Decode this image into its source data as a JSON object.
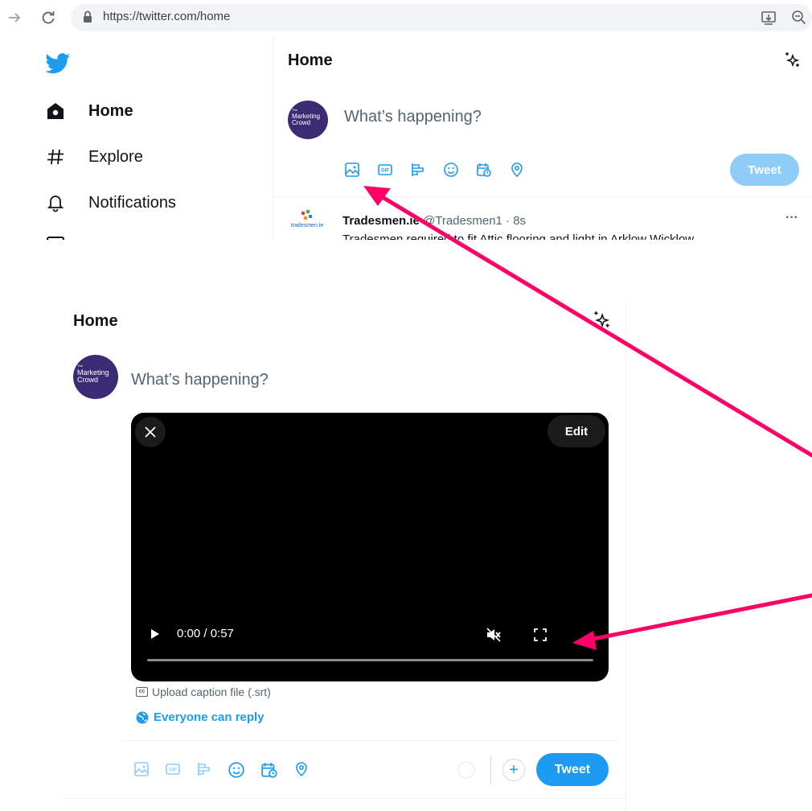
{
  "browser": {
    "url": "https://twitter.com/home",
    "icons": [
      "forward-arrow-icon",
      "reload-icon",
      "lock-icon",
      "install-app-icon",
      "zoom-icon"
    ]
  },
  "sidebar": {
    "items": [
      {
        "label": "Home",
        "icon": "home-icon",
        "active": true
      },
      {
        "label": "Explore",
        "icon": "hashtag-icon"
      },
      {
        "label": "Notifications",
        "icon": "bell-icon"
      }
    ]
  },
  "top_composer": {
    "title": "Home",
    "avatar_text_small": "The",
    "avatar_text_1": "Marketing",
    "avatar_text_2": "Crowd",
    "placeholder": "What’s happening?",
    "toolbar_icons": [
      "media-icon",
      "gif-icon",
      "poll-icon",
      "emoji-icon",
      "schedule-icon",
      "location-icon"
    ],
    "tweet_label": "Tweet"
  },
  "feed": {
    "name": "Tradesmen.ie",
    "handle": "@Tradesmen1 · 8s",
    "logo_text": "tradesmen.ie",
    "text": "Tradesmen required to fit Attic flooring and light in Arklow Wicklow",
    "more": "···"
  },
  "bottom_composer": {
    "title": "Home",
    "avatar_text_small": "The",
    "avatar_text_1": "Marketing",
    "avatar_text_2": "Crowd",
    "placeholder": "What’s happening?",
    "video": {
      "edit_label": "Edit",
      "time": "0:00 / 0:57",
      "progress": 0
    },
    "caption_label": "Upload caption file (.srt)",
    "cc_label": "cc",
    "reply_label": "Everyone can reply",
    "add_label": "+",
    "tweet_label": "Tweet"
  },
  "colors": {
    "accent": "#1d9bf0",
    "accent_disabled": "#8ecdf8",
    "avatar": "#3b2a74",
    "annotation_arrow": "#ff0066"
  }
}
